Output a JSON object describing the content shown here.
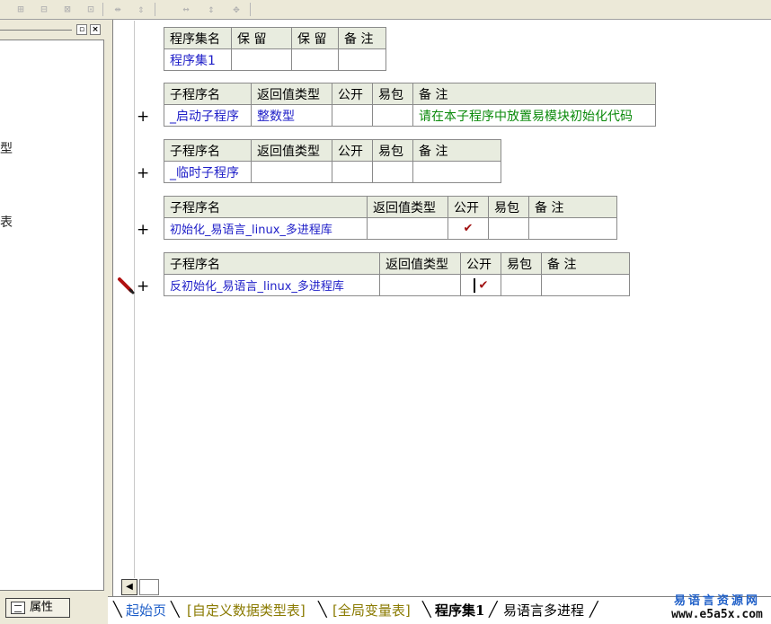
{
  "toolbar": {
    "icons": [
      "insert-row-icon",
      "insert-col-icon",
      "split-cell-icon",
      "merge-cell-icon",
      "col-width-icon",
      "row-height-icon",
      "fit-width-icon",
      "fit-height-icon",
      "fit-all-icon"
    ]
  },
  "left_panel": {
    "tree_fragments": [
      "型",
      "表"
    ],
    "properties_tab_label": "属性"
  },
  "program_set": {
    "headers": [
      "程序集名",
      "保 留",
      "保 留",
      "备 注"
    ],
    "row": [
      "程序集1",
      "",
      "",
      ""
    ]
  },
  "subprograms": [
    {
      "headers": [
        "子程序名",
        "返回值类型",
        "公开",
        "易包",
        "备 注"
      ],
      "name": "_启动子程序",
      "return_type": "整数型",
      "public": "",
      "easy_pkg": "",
      "remark": "请在本子程序中放置易模块初始化代码"
    },
    {
      "headers": [
        "子程序名",
        "返回值类型",
        "公开",
        "易包",
        "备 注"
      ],
      "name": "_临时子程序",
      "return_type": "",
      "public": "",
      "easy_pkg": "",
      "remark": ""
    },
    {
      "headers": [
        "子程序名",
        "返回值类型",
        "公开",
        "易包",
        "备 注"
      ],
      "name": "初始化_易语言_linux_多进程库",
      "return_type": "",
      "public": "✔",
      "easy_pkg": "",
      "remark": ""
    },
    {
      "headers": [
        "子程序名",
        "返回值类型",
        "公开",
        "易包",
        "备 注"
      ],
      "name": "反初始化_易语言_linux_多进程库",
      "return_type": "",
      "public": "✔",
      "easy_pkg": "",
      "remark": ""
    }
  ],
  "expand_symbol": "+",
  "tabs": [
    "起始页",
    "[自定义数据类型表]",
    "[全局变量表]",
    "程序集1",
    "易语言多进程"
  ],
  "watermark": {
    "line1": "易语言资源网",
    "line2": "www.e5a5x.com"
  },
  "colors": {
    "header_bg": "#e8ecdf",
    "name_blue": "#1e1ec8",
    "remark_green": "#0a8a0a",
    "check_red": "#a01010"
  }
}
